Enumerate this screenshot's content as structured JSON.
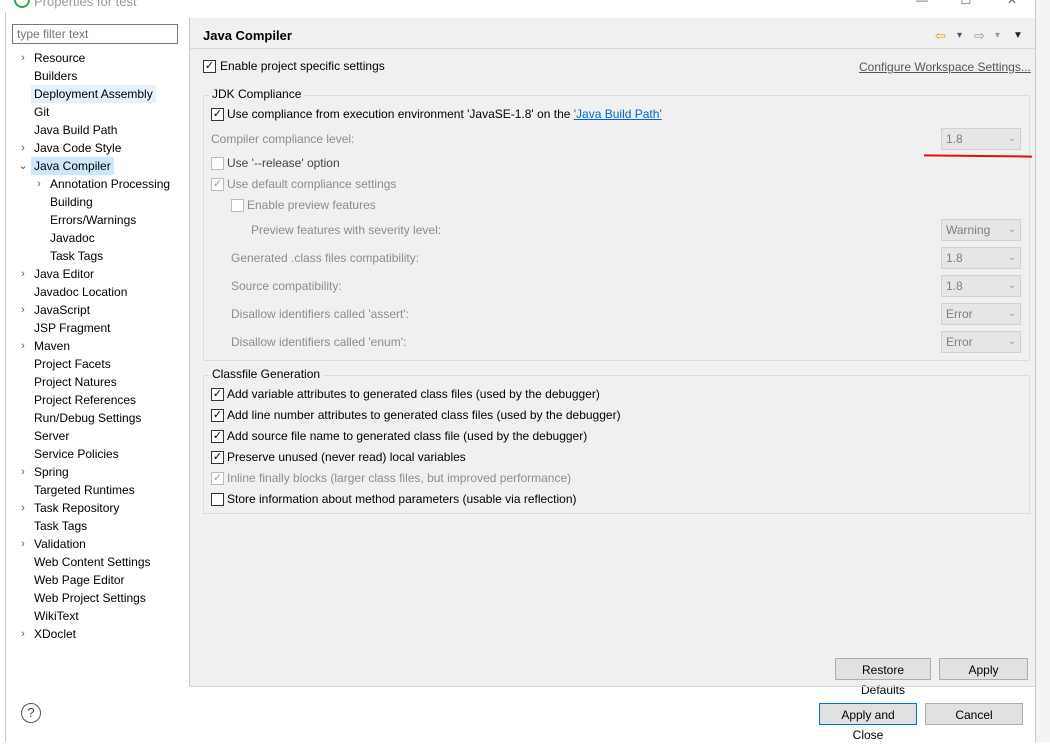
{
  "window": {
    "title": "Properties for test",
    "minimize": "—",
    "maximize": "☐",
    "close": "✕"
  },
  "filter": {
    "placeholder": "type filter text"
  },
  "tree": [
    {
      "label": "Resource",
      "level": 0,
      "expander": "›"
    },
    {
      "label": "Builders",
      "level": 0,
      "expander": ""
    },
    {
      "label": "Deployment Assembly",
      "level": 0,
      "expander": ""
    },
    {
      "label": "Git",
      "level": 0,
      "expander": ""
    },
    {
      "label": "Java Build Path",
      "level": 0,
      "expander": ""
    },
    {
      "label": "Java Code Style",
      "level": 0,
      "expander": "›"
    },
    {
      "label": "Java Compiler",
      "level": 0,
      "expander": "⌄"
    },
    {
      "label": "Annotation Processing",
      "level": 1,
      "expander": "›"
    },
    {
      "label": "Building",
      "level": 1,
      "expander": ""
    },
    {
      "label": "Errors/Warnings",
      "level": 1,
      "expander": ""
    },
    {
      "label": "Javadoc",
      "level": 1,
      "expander": ""
    },
    {
      "label": "Task Tags",
      "level": 1,
      "expander": ""
    },
    {
      "label": "Java Editor",
      "level": 0,
      "expander": "›"
    },
    {
      "label": "Javadoc Location",
      "level": 0,
      "expander": ""
    },
    {
      "label": "JavaScript",
      "level": 0,
      "expander": "›"
    },
    {
      "label": "JSP Fragment",
      "level": 0,
      "expander": ""
    },
    {
      "label": "Maven",
      "level": 0,
      "expander": "›"
    },
    {
      "label": "Project Facets",
      "level": 0,
      "expander": ""
    },
    {
      "label": "Project Natures",
      "level": 0,
      "expander": ""
    },
    {
      "label": "Project References",
      "level": 0,
      "expander": ""
    },
    {
      "label": "Run/Debug Settings",
      "level": 0,
      "expander": ""
    },
    {
      "label": "Server",
      "level": 0,
      "expander": ""
    },
    {
      "label": "Service Policies",
      "level": 0,
      "expander": ""
    },
    {
      "label": "Spring",
      "level": 0,
      "expander": "›"
    },
    {
      "label": "Targeted Runtimes",
      "level": 0,
      "expander": ""
    },
    {
      "label": "Task Repository",
      "level": 0,
      "expander": "›"
    },
    {
      "label": "Task Tags",
      "level": 0,
      "expander": ""
    },
    {
      "label": "Validation",
      "level": 0,
      "expander": "›"
    },
    {
      "label": "Web Content Settings",
      "level": 0,
      "expander": ""
    },
    {
      "label": "Web Page Editor",
      "level": 0,
      "expander": ""
    },
    {
      "label": "Web Project Settings",
      "level": 0,
      "expander": ""
    },
    {
      "label": "WikiText",
      "level": 0,
      "expander": ""
    },
    {
      "label": "XDoclet",
      "level": 0,
      "expander": "›"
    }
  ],
  "page": {
    "title": "Java Compiler",
    "nav": {
      "back": "⇦",
      "back_menu": "▾",
      "forward": "⇨",
      "forward_menu": "▾",
      "view_menu": "▼"
    },
    "enable_specific": {
      "label": "Enable project specific settings",
      "checked": "✓"
    },
    "configure_link": "Configure Workspace Settings...",
    "jdk": {
      "title": "JDK Compliance",
      "use_compliance_prefix": "Use compliance from execution environment 'JavaSE-1.8' on the ",
      "use_compliance_link": "'Java Build Path'",
      "use_compliance_checked": "✓",
      "compliance_level_label": "Compiler compliance level:",
      "compliance_level_value": "1.8",
      "release_label": "Use '--release' option",
      "default_label": "Use default compliance settings",
      "default_checked": "✓",
      "preview_label": "Enable preview features",
      "preview_severity_label": "Preview features with severity level:",
      "preview_severity_value": "Warning",
      "generated_label": "Generated .class files compatibility:",
      "generated_value": "1.8",
      "source_label": "Source compatibility:",
      "source_value": "1.8",
      "assert_label": "Disallow identifiers called 'assert':",
      "assert_value": "Error",
      "enum_label": "Disallow identifiers called 'enum':",
      "enum_value": "Error",
      "combo_arrow": "⌄"
    },
    "classfile": {
      "title": "Classfile Generation",
      "items": [
        {
          "label": "Add variable attributes to generated class files (used by the debugger)",
          "checked": "✓"
        },
        {
          "label": "Add line number attributes to generated class files (used by the debugger)",
          "checked": "✓"
        },
        {
          "label": "Add source file name to generated class file (used by the debugger)",
          "checked": "✓"
        },
        {
          "label": "Preserve unused (never read) local variables",
          "checked": "✓"
        },
        {
          "label": "Inline finally blocks (larger class files, but improved performance)",
          "checked": "✓"
        },
        {
          "label": "Store information about method parameters (usable via reflection)",
          "checked": ""
        }
      ]
    },
    "restore_defaults": "Restore Defaults",
    "apply": "Apply"
  },
  "footer": {
    "help": "?",
    "apply_close": "Apply and Close",
    "cancel": "Cancel"
  },
  "colors": {
    "selection": "#cce8ff",
    "hover": "#e5f1fb",
    "annotation_line": "#e01010",
    "link": "#0066cc"
  }
}
